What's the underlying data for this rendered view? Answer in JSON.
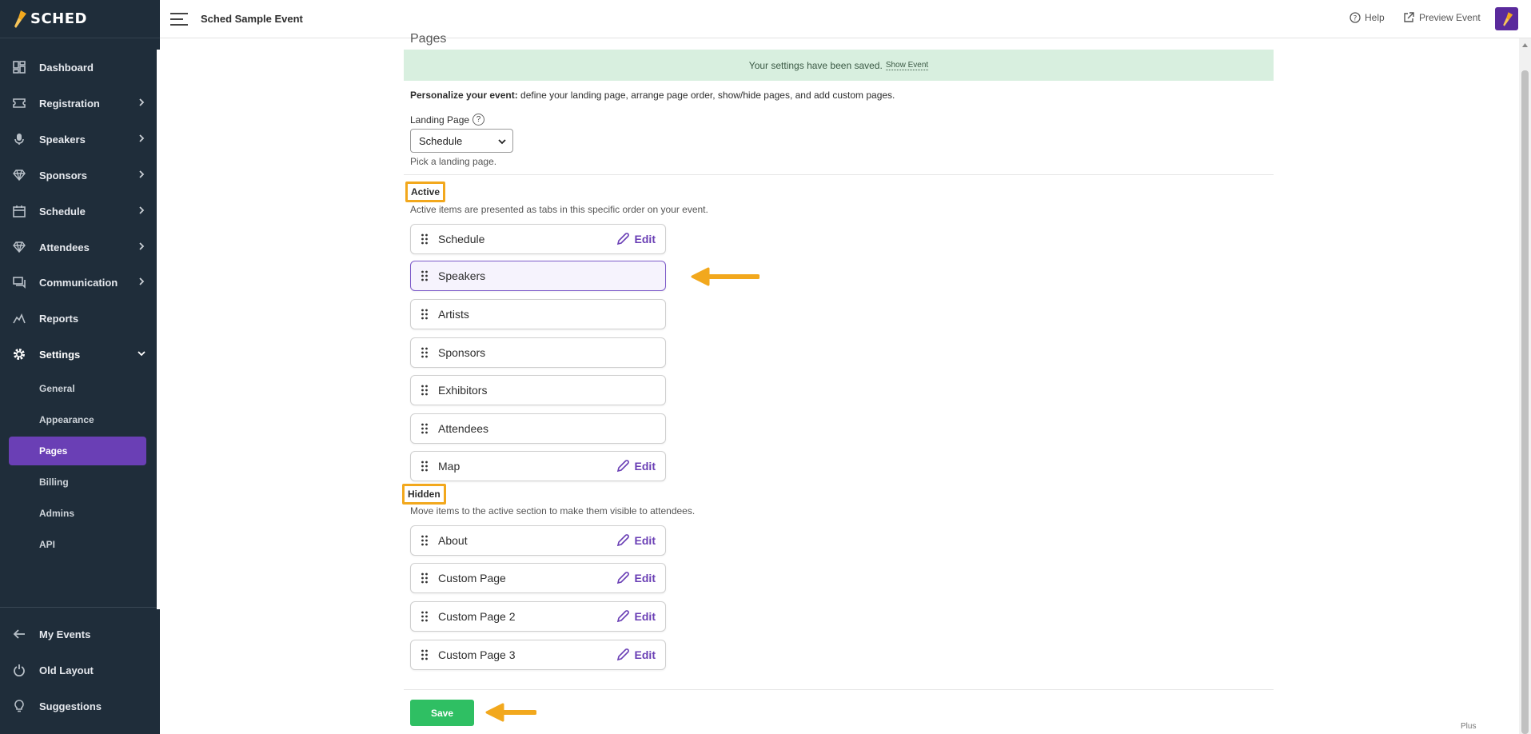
{
  "brand": {
    "name": "SCHED"
  },
  "sidebar": {
    "items": [
      {
        "label": "Dashboard",
        "icon": "dashboard-icon"
      },
      {
        "label": "Registration",
        "icon": "ticket-icon"
      },
      {
        "label": "Speakers",
        "icon": "microphone-icon"
      },
      {
        "label": "Sponsors",
        "icon": "diamond-icon"
      },
      {
        "label": "Schedule",
        "icon": "calendar-icon"
      },
      {
        "label": "Attendees",
        "icon": "diamond-icon"
      },
      {
        "label": "Communication",
        "icon": "chat-icon"
      },
      {
        "label": "Reports",
        "icon": "chart-icon"
      },
      {
        "label": "Settings",
        "icon": "gear-icon"
      }
    ],
    "settings_sub": [
      "General",
      "Appearance",
      "Pages",
      "Billing",
      "Admins",
      "API"
    ],
    "active_sub": "Pages",
    "bottom": [
      {
        "label": "My Events",
        "icon": "arrow-left-icon"
      },
      {
        "label": "Old Layout",
        "icon": "power-icon"
      },
      {
        "label": "Suggestions",
        "icon": "lightbulb-icon"
      }
    ]
  },
  "topbar": {
    "event_title": "Sched Sample Event",
    "help_label": "Help",
    "preview_label": "Preview Event"
  },
  "page": {
    "heading": "Pages",
    "alert_text": "Your settings have been saved.",
    "alert_link": "Show Event",
    "intro_bold": "Personalize your event:",
    "intro_rest": " define your landing page, arrange page order, show/hide pages, and add custom pages.",
    "landing_label": "Landing Page",
    "landing_value": "Schedule",
    "landing_help": "Pick a landing page.",
    "active_title": "Active",
    "active_desc": "Active items are presented as tabs in this specific order on your event.",
    "active_items": [
      {
        "label": "Schedule",
        "edit": "Edit"
      },
      {
        "label": "Speakers",
        "edit": ""
      },
      {
        "label": "Artists",
        "edit": ""
      },
      {
        "label": "Sponsors",
        "edit": ""
      },
      {
        "label": "Exhibitors",
        "edit": ""
      },
      {
        "label": "Attendees",
        "edit": ""
      },
      {
        "label": "Map",
        "edit": "Edit"
      }
    ],
    "hidden_title": "Hidden",
    "hidden_desc": "Move items to the active section to make them visible to attendees.",
    "hidden_items": [
      {
        "label": "About",
        "edit": "Edit"
      },
      {
        "label": "Custom Page",
        "edit": "Edit"
      },
      {
        "label": "Custom Page 2",
        "edit": "Edit"
      },
      {
        "label": "Custom Page 3",
        "edit": "Edit"
      }
    ],
    "save_label": "Save",
    "plan_tag": "Plus"
  },
  "colors": {
    "sidebar_bg": "#1f2d3a",
    "accent": "#6a3fb5",
    "save": "#2fbf63",
    "alert_bg": "#d8efdf",
    "annotation": "#f2a81d"
  }
}
